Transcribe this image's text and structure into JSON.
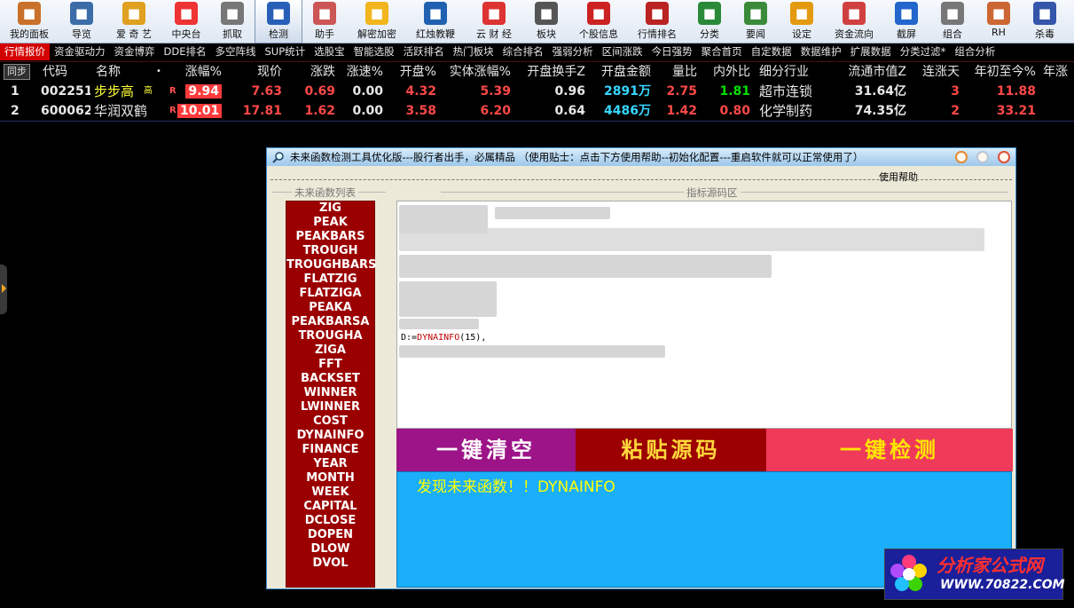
{
  "toolbar": [
    {
      "label": "我的面板",
      "color": "#c9702a",
      "icon": "panel"
    },
    {
      "label": "导览",
      "color": "#3b6ca8",
      "icon": "building"
    },
    {
      "label": "爱 奇 艺",
      "color": "#e0a020",
      "icon": "person"
    },
    {
      "label": "中央台",
      "color": "#e33",
      "icon": "tv"
    },
    {
      "label": "抓取",
      "color": "#777",
      "icon": "grab"
    },
    {
      "label": "检测",
      "color": "#2860b8",
      "icon": "detect"
    },
    {
      "label": "助手",
      "color": "#c55",
      "icon": "helper"
    },
    {
      "label": "解密加密",
      "color": "#f2b51e",
      "icon": "smiley"
    },
    {
      "label": "红烛教鞭",
      "color": "#2060b0",
      "icon": "flag"
    },
    {
      "label": "云 财 经",
      "color": "#d33",
      "icon": "chart"
    },
    {
      "label": "板块",
      "color": "#555",
      "icon": "printer"
    },
    {
      "label": "个股信息",
      "color": "#c22",
      "icon": "news"
    },
    {
      "label": "行情排名",
      "color": "#b22",
      "icon": "ranking"
    },
    {
      "label": "分类",
      "color": "#2a8a3a",
      "icon": "category"
    },
    {
      "label": "要闻",
      "color": "#3a8a3a",
      "icon": "money"
    },
    {
      "label": "设定",
      "color": "#e39a10",
      "icon": "clock"
    },
    {
      "label": "资金流向",
      "color": "#d04040",
      "icon": "flow"
    },
    {
      "label": "截屏",
      "color": "#2266cc",
      "icon": "cart"
    },
    {
      "label": "组合",
      "color": "#777",
      "icon": "combine"
    },
    {
      "label": "RH",
      "color": "#cc6633",
      "icon": "rh"
    },
    {
      "label": "杀毒",
      "color": "#3355aa",
      "icon": "antivirus"
    }
  ],
  "tabs": [
    "行情报价",
    "资金驱动力",
    "资金博弈",
    "DDE排名",
    "多空阵线",
    "SUP统计",
    "选股宝",
    "智能选股",
    "活跃排名",
    "热门板块",
    "综合排名",
    "强弱分析",
    "区间涨跌",
    "今日强势",
    "聚合首页",
    "自定数据",
    "数据维护",
    "扩展数据",
    "分类过滤*",
    "组合分析"
  ],
  "table": {
    "sync_label": "同步",
    "headers": [
      "代码",
      "名称",
      "•",
      "涨幅%",
      "现价",
      "涨跌",
      "涨速%",
      "开盘%",
      "实体涨幅%",
      "开盘换手Z",
      "开盘金额",
      "量比",
      "内外比",
      "细分行业",
      "流通市值Z",
      "连涨天",
      "年初至今%",
      "年涨"
    ],
    "rows": [
      {
        "idx": "1",
        "code": "002251",
        "name": "步步高",
        "name_sub": "高",
        "mark": "R",
        "pct": "9.94",
        "price": "7.63",
        "chg": "0.69",
        "speed": "0.00",
        "open_pct": "4.32",
        "body_pct": "5.39",
        "turnover": "0.96",
        "open_amt": "2891万",
        "vol_ratio": "2.75",
        "in_out": "1.81",
        "industry": "超市连锁",
        "float_cap": "31.64亿",
        "up_days": "3",
        "ytd": "11.88"
      },
      {
        "idx": "2",
        "code": "600062",
        "name": "华润双鹤",
        "name_sub": "",
        "mark": "R",
        "pct": "10.01",
        "price": "17.81",
        "chg": "1.62",
        "speed": "0.00",
        "open_pct": "3.58",
        "body_pct": "6.20",
        "turnover": "0.64",
        "open_amt": "4486万",
        "vol_ratio": "1.42",
        "in_out": "0.80",
        "industry": "化学制药",
        "float_cap": "74.35亿",
        "up_days": "2",
        "ytd": "33.21"
      }
    ]
  },
  "dialog": {
    "title": "未来函数检测工具优化版---股行者出手，必属精品 （使用贴士：点击下方使用帮助--初始化配置---重启软件就可以正常使用了）",
    "help": "使用帮助",
    "list_title": "未来函数列表",
    "code_title": "指标源码区",
    "functions": [
      "ZIG",
      "PEAK",
      "PEAKBARS",
      "TROUGH",
      "TROUGHBARS",
      "FLATZIG",
      "FLATZIGA",
      "PEAKA",
      "PEAKBARSA",
      "TROUGHA",
      "ZIGA",
      "FFT",
      "BACKSET",
      "WINNER",
      "LWINNER",
      "COST",
      "DYNAINFO",
      "FINANCE",
      "YEAR",
      "MONTH",
      "WEEK",
      "CAPITAL",
      "DCLOSE",
      "DOPEN",
      "DLOW",
      "DVOL"
    ],
    "code_prefix": "D:=",
    "code_func": "DYNAINFO",
    "code_suffix": "(15),",
    "btn_clear": "一键清空",
    "btn_paste": "粘贴源码",
    "btn_check": "一键检测",
    "result": "发现未来函数！！DYNAINFO"
  },
  "watermark": {
    "name": "分析家公式网",
    "url": "WWW.70822.COM"
  }
}
